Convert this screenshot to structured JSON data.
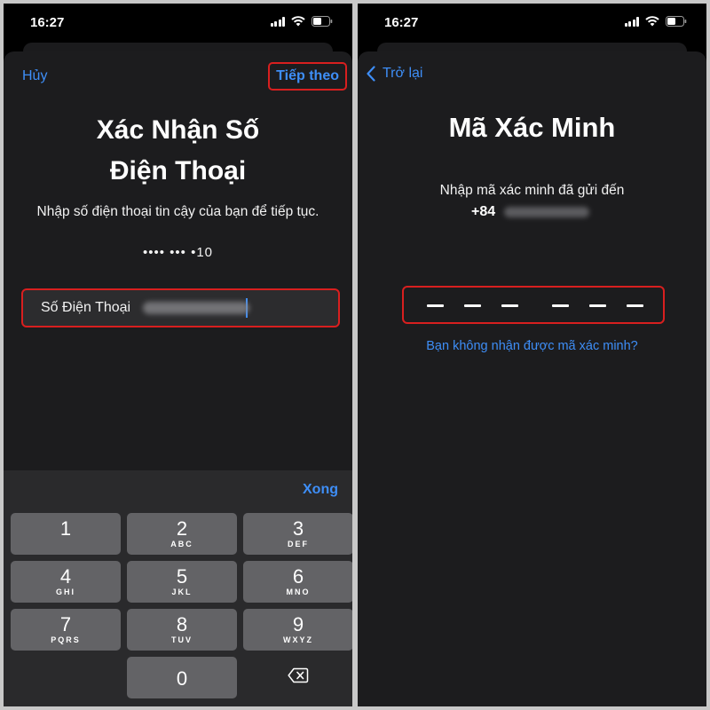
{
  "left_screen": {
    "status_bar": {
      "time": "16:27"
    },
    "nav": {
      "cancel_label": "Hủy",
      "next_label": "Tiếp theo"
    },
    "title_line1": "Xác Nhận Số",
    "title_line2": "Điện Thoại",
    "subtitle": "Nhập số điện thoại tin cậy của bạn để tiếp tục.",
    "masked_number": "•••• ••• •10",
    "phone_field": {
      "label": "Số Điện Thoại"
    },
    "keyboard": {
      "done_label": "Xong",
      "keys": [
        {
          "digit": "1",
          "letters": ""
        },
        {
          "digit": "2",
          "letters": "ABC"
        },
        {
          "digit": "3",
          "letters": "DEF"
        },
        {
          "digit": "4",
          "letters": "GHI"
        },
        {
          "digit": "5",
          "letters": "JKL"
        },
        {
          "digit": "6",
          "letters": "MNO"
        },
        {
          "digit": "7",
          "letters": "PQRS"
        },
        {
          "digit": "8",
          "letters": "TUV"
        },
        {
          "digit": "9",
          "letters": "WXYZ"
        },
        {
          "digit": "0",
          "letters": ""
        }
      ],
      "delete_icon": "backspace-icon"
    }
  },
  "right_screen": {
    "status_bar": {
      "time": "16:27"
    },
    "nav": {
      "back_label": "Trở lại"
    },
    "title": "Mã Xác Minh",
    "subtitle": "Nhập mã xác minh đã gửi đến",
    "country_code": "+84",
    "code_digits": 6,
    "resend_link": "Bạn không nhận được mã xác minh?"
  },
  "colors": {
    "accent": "#3e8ef7",
    "highlight_border": "#d81f1f",
    "sheet_bg": "#1c1c1e",
    "key_bg": "#636366"
  }
}
